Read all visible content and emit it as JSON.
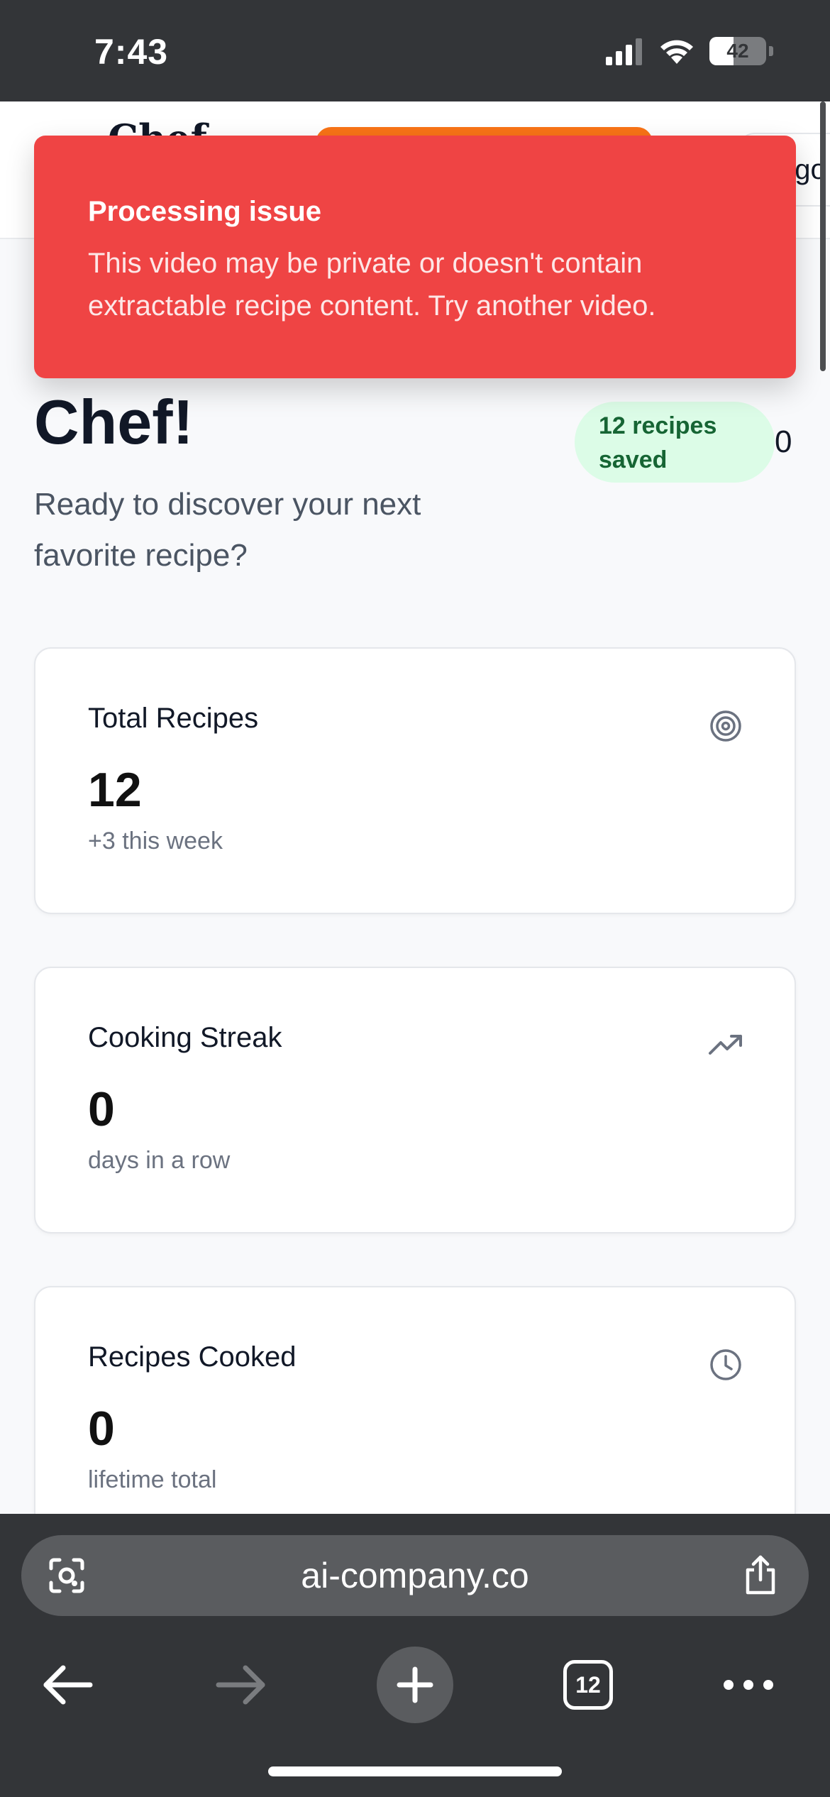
{
  "status_bar": {
    "time": "7:43",
    "battery_level": "42",
    "battery_fraction": 0.42
  },
  "header": {
    "brand": "Chef",
    "partial_label": "ogo"
  },
  "toast": {
    "title": "Processing issue",
    "message": "This video may be private or doesn't contain extractable recipe content. Try another video.",
    "color": "#ef4444"
  },
  "greeting": {
    "title": "Chef!",
    "subtitle": "Ready to discover your next favorite recipe?",
    "badge": "12 recipes saved",
    "overflow_digit": "0"
  },
  "stats": [
    {
      "label": "Total Recipes",
      "value": "12",
      "note": "+3 this week",
      "icon": "target-icon"
    },
    {
      "label": "Cooking Streak",
      "value": "0",
      "note": "days in a row",
      "icon": "trending-up-icon"
    },
    {
      "label": "Recipes Cooked",
      "value": "0",
      "note": "lifetime total",
      "icon": "clock-icon"
    }
  ],
  "browser": {
    "url": "ai-company.co",
    "tab_count": "12"
  },
  "colors": {
    "brand_orange": "#f97316",
    "badge_green_bg": "#dcfce7",
    "badge_green_text": "#166534"
  }
}
